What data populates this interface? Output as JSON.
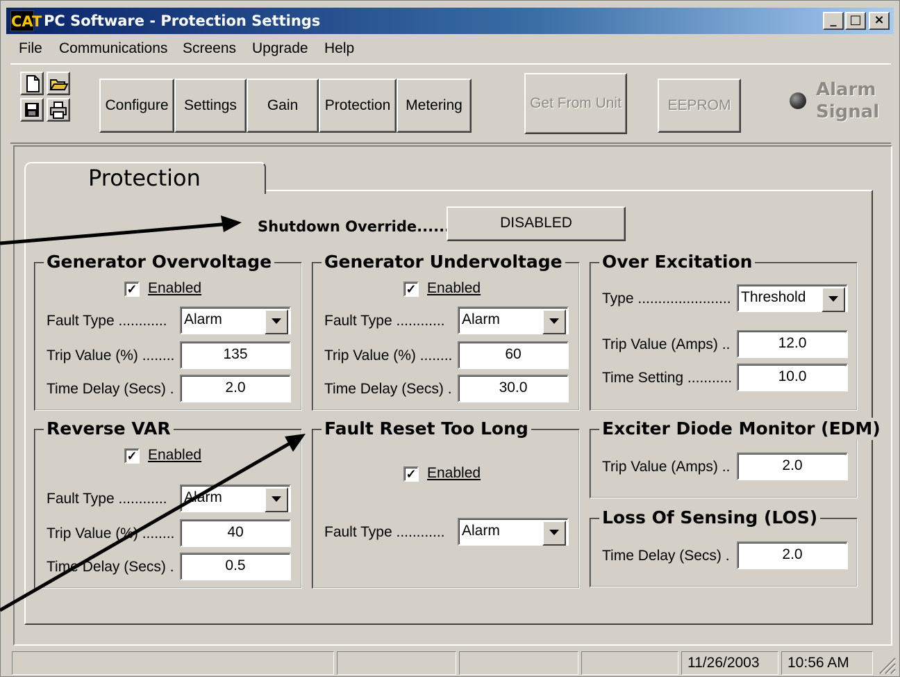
{
  "window": {
    "title": "PC Software - Protection Settings",
    "app_icon": "CAT",
    "minimize": "_",
    "maximize": "□",
    "close": "×"
  },
  "menu": [
    "File",
    "Communications",
    "Screens",
    "Upgrade",
    "Help"
  ],
  "toolbar": {
    "icons": [
      "new-file-icon",
      "open-folder-icon",
      "save-disk-icon",
      "print-icon"
    ],
    "buttons": [
      "Configure",
      "Settings",
      "Gain",
      "Protection",
      "Metering"
    ],
    "get_from_unit": "Get From Unit",
    "eeprom": "EEPROM",
    "alarm_line1": "Alarm",
    "alarm_line2": "Signal"
  },
  "tab": {
    "label": "Protection"
  },
  "shutdown_override": {
    "label": "Shutdown Override.......",
    "value": "DISABLED"
  },
  "groups": {
    "gen_overvoltage": {
      "title": "Generator Overvoltage",
      "enabled_label": "Enabled",
      "enabled": true,
      "fault_type_label": "Fault Type ............",
      "fault_type": "Alarm",
      "trip_label": "Trip Value (%) ........",
      "trip": "135",
      "delay_label": "Time Delay (Secs) .",
      "delay": "2.0"
    },
    "gen_undervoltage": {
      "title": "Generator Undervoltage",
      "enabled_label": "Enabled",
      "enabled": true,
      "fault_type_label": "Fault Type ............",
      "fault_type": "Alarm",
      "trip_label": "Trip Value (%) ........",
      "trip": "60",
      "delay_label": "Time Delay (Secs) .",
      "delay": "30.0"
    },
    "over_excitation": {
      "title": "Over Excitation",
      "type_label": "Type .......................",
      "type": "Threshold",
      "trip_label": "Trip Value (Amps) ..",
      "trip": "12.0",
      "time_label": "Time Setting ...........",
      "time": "10.0"
    },
    "reverse_var": {
      "title": "Reverse VAR",
      "enabled_label": "Enabled",
      "enabled": true,
      "fault_type_label": "Fault Type ............",
      "fault_type": "Alarm",
      "trip_label": "Trip Value (%) ........",
      "trip": "40",
      "delay_label": "Time Delay (Secs) .",
      "delay": "0.5"
    },
    "fault_reset": {
      "title": "Fault Reset Too Long",
      "enabled_label": "Enabled",
      "enabled": true,
      "fault_type_label": "Fault Type ............",
      "fault_type": "Alarm"
    },
    "edm": {
      "title": "Exciter Diode Monitor (EDM)",
      "trip_label": "Trip Value (Amps) ..",
      "trip": "2.0"
    },
    "los": {
      "title": "Loss Of Sensing (LOS)",
      "delay_label": "Time Delay (Secs) .",
      "delay": "2.0"
    }
  },
  "checkmark": "✓",
  "status_bar": {
    "date": "11/26/2003",
    "time": "10:56 AM"
  }
}
